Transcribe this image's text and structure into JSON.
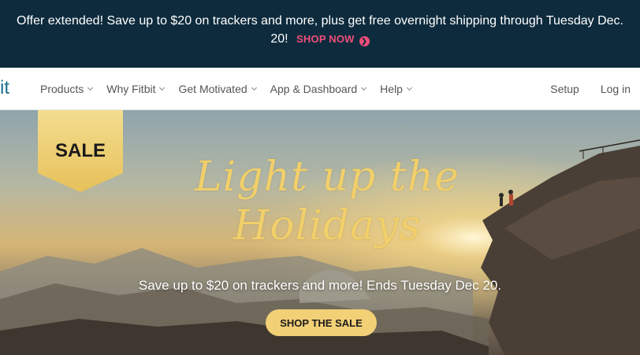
{
  "promo": {
    "text": "Offer extended! Save up to $20 on trackers and more, plus get free overnight shipping through Tuesday Dec. 20!",
    "cta_label": "SHOP NOW",
    "cta_icon": "chevron-right-circle-icon",
    "background": "#0e2b3d",
    "accent": "#ef4e7a"
  },
  "nav": {
    "logo_text": "it",
    "items": [
      {
        "label": "Products"
      },
      {
        "label": "Why Fitbit"
      },
      {
        "label": "Get Motivated"
      },
      {
        "label": "App & Dashboard"
      },
      {
        "label": "Help"
      }
    ],
    "right": {
      "setup": "Setup",
      "login": "Log in"
    }
  },
  "hero": {
    "badge": "SALE",
    "headline_line1": "Light up the",
    "headline_line2": "Holidays",
    "subline": "Save up to $20 on trackers and more! Ends Tuesday Dec 20.",
    "cta_label": "SHOP THE SALE",
    "accent": "#f2d076"
  }
}
